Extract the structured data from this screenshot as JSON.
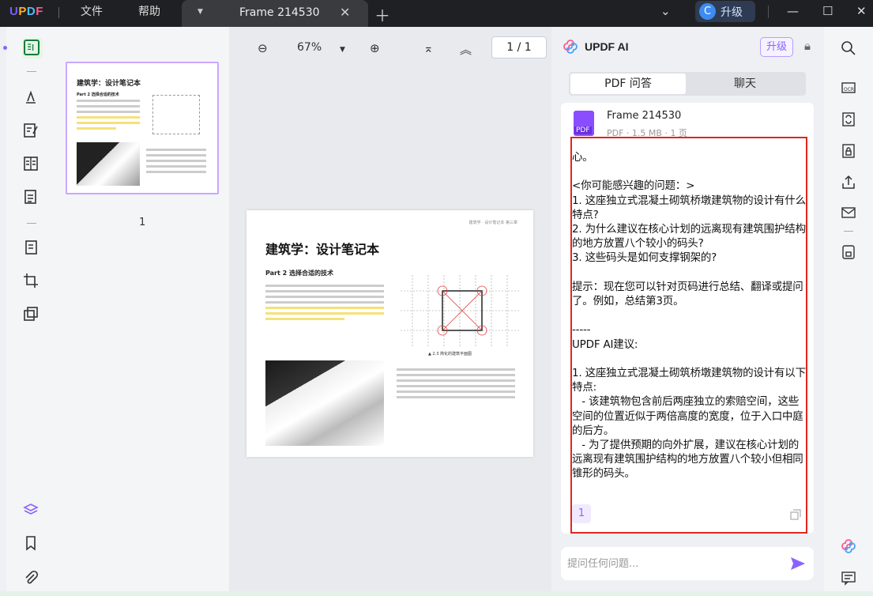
{
  "titlebar": {
    "logo": {
      "u": "U",
      "p": "P",
      "d": "D",
      "f": "F"
    },
    "menus": [
      "文件",
      "帮助"
    ],
    "tab_name": "Frame 214530",
    "upgrade_avatar": "C",
    "upgrade_label": "升级"
  },
  "thumbnails": {
    "page_label": "1",
    "title": "建筑学：设计笔记本",
    "part": "Part 2   选择合适的技术"
  },
  "viewer": {
    "zoom": "67%",
    "page_indicator": "1 / 1",
    "page": {
      "header": "建筑学 · 设计笔记本 第三章",
      "title": "建筑学：设计笔记本",
      "part": "Part 2   选择合适的技术",
      "caption": "▲ 2.3  简化的建筑平面图"
    }
  },
  "ai_panel": {
    "title": "UPDF AI",
    "upgrade": "升级",
    "tabs": [
      "PDF 问答",
      "聊天"
    ],
    "file": {
      "name": "Frame 214530",
      "meta": "PDF · 1.5 MB · 1 页",
      "badge": "PDF"
    },
    "answer": "心。\n\n<你可能感兴趣的问题：>\n1. 这座独立式混凝土砌筑桥墩建筑物的设计有什么特点?\n2. 为什么建议在核心计划的远离现有建筑围护结构的地方放置八个较小的码头?\n3. 这些码头是如何支撑钢架的?\n\n提示：现在您可以针对页码进行总结、翻译或提问了。例如，总结第3页。\n\n-----\nUPDF AI建议:\n\n1. 这座独立式混凝土砌筑桥墩建筑物的设计有以下特点:\n   - 该建筑物包含前后两座独立的索赔空间，这些空间的位置近似于两倍高度的宽度，位于入口中庭的后方。\n   - 为了提供预期的向外扩展，建议在核心计划的远离现有建筑围护结构的地方放置八个较小但相同锥形的码头。",
    "citation": "1",
    "input_placeholder": "提问任何问题..."
  },
  "colors": {
    "accent": "#8a63ff",
    "highlight_box": "#e0261e"
  }
}
